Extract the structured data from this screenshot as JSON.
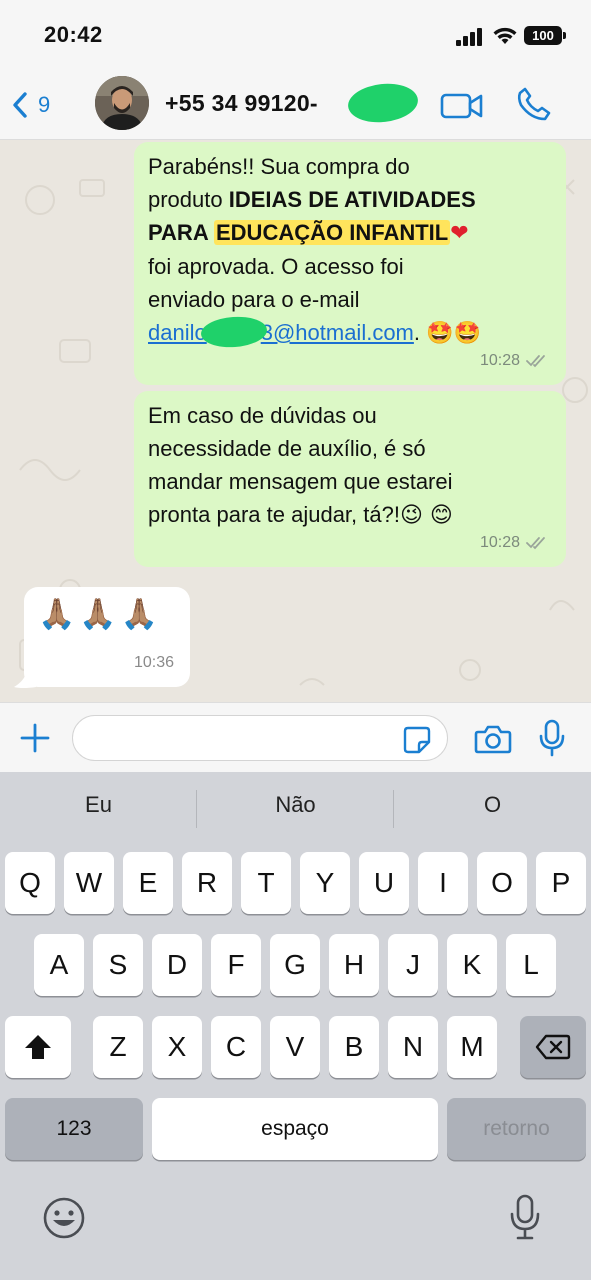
{
  "status_bar": {
    "time": "20:42",
    "battery": "100"
  },
  "header": {
    "back_count": "9",
    "contact_name": "+55 34 99120-"
  },
  "messages": [
    {
      "direction": "outgoing",
      "parts": {
        "l1": "Parabéns!! Sua compra do",
        "l2a": "produto ",
        "l2b": "IDEIAS DE ATIVIDADES",
        "l3a": "PARA ",
        "l3b": "EDUCAÇÃO INFANTIL",
        "l3c": "❤",
        "l4": "foi aprovada. O acesso foi",
        "l5": "enviado para o e-mail",
        "email_start": "danilo",
        "email_end": "3@hotmail.com",
        "trailing": ".",
        "emojis": "🤩🤩"
      },
      "time": "10:28"
    },
    {
      "direction": "outgoing",
      "lines": [
        "Em caso de dúvidas ou",
        "necessidade de auxílio, é só",
        "mandar mensagem que estarei",
        "pronta para te ajudar, tá?!"
      ],
      "emojis": "😉 😊",
      "time": "10:28"
    },
    {
      "direction": "incoming",
      "text": "🙏🏽🙏🏽🙏🏽",
      "time": "10:36"
    }
  ],
  "input": {
    "value": "",
    "placeholder": ""
  },
  "keyboard": {
    "suggestions": [
      "Eu",
      "Não",
      "O"
    ],
    "row1": [
      "Q",
      "W",
      "E",
      "R",
      "T",
      "Y",
      "U",
      "I",
      "O",
      "P"
    ],
    "row2": [
      "A",
      "S",
      "D",
      "F",
      "G",
      "H",
      "J",
      "K",
      "L"
    ],
    "row3": [
      "Z",
      "X",
      "C",
      "V",
      "B",
      "N",
      "M"
    ],
    "numbers_key": "123",
    "space_key": "espaço",
    "return_key": "retorno"
  },
  "colors": {
    "accent": "#1b7fd1",
    "outgoing_bubble": "#dcf8c6",
    "incoming_bubble": "#ffffff",
    "chat_background": "#eae6df",
    "highlight": "#ffe45c",
    "redaction": "#1fd16a"
  }
}
